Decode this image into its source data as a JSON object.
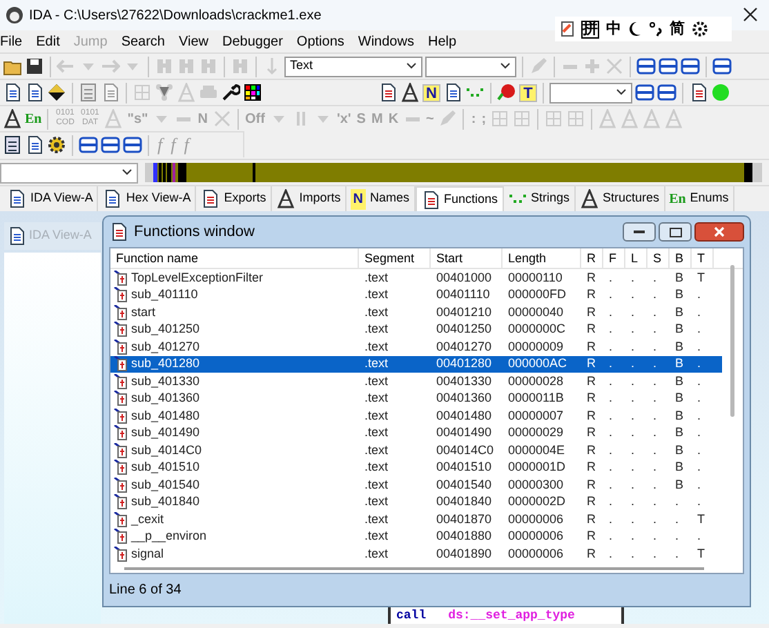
{
  "window": {
    "title": "IDA - C:\\Users\\27622\\Downloads\\crackme1.exe"
  },
  "ime_bar": [
    "拼",
    "中",
    "简"
  ],
  "menu": [
    {
      "label": "File",
      "disabled": false
    },
    {
      "label": "Edit",
      "disabled": false
    },
    {
      "label": "Jump",
      "disabled": true
    },
    {
      "label": "Search",
      "disabled": false
    },
    {
      "label": "View",
      "disabled": false
    },
    {
      "label": "Debugger",
      "disabled": false
    },
    {
      "label": "Options",
      "disabled": false
    },
    {
      "label": "Windows",
      "disabled": false
    },
    {
      "label": "Help",
      "disabled": false
    }
  ],
  "toolbars": [
    [
      {
        "kind": "icon",
        "disabled": false
      },
      {
        "kind": "icon",
        "disabled": false
      },
      {
        "kind": "sep"
      },
      {
        "kind": "icon",
        "disabled": true
      },
      {
        "kind": "icon",
        "disabled": true
      },
      {
        "kind": "icon",
        "disabled": true
      },
      {
        "kind": "icon",
        "disabled": true
      },
      {
        "kind": "sep"
      },
      {
        "kind": "icon",
        "disabled": true
      },
      {
        "kind": "icon",
        "disabled": true
      },
      {
        "kind": "icon",
        "disabled": true
      },
      {
        "kind": "sep"
      },
      {
        "kind": "icon",
        "disabled": true
      },
      {
        "kind": "sep"
      },
      {
        "kind": "icon",
        "disabled": true
      },
      {
        "kind": "combo",
        "value": "Text"
      },
      {
        "kind": "combo"
      },
      {
        "kind": "sep"
      },
      {
        "kind": "icon",
        "disabled": true
      },
      {
        "kind": "sep"
      },
      {
        "kind": "icon",
        "disabled": true
      },
      {
        "kind": "icon",
        "disabled": true
      },
      {
        "kind": "icon",
        "disabled": true
      },
      {
        "kind": "sep"
      },
      {
        "kind": "icon",
        "disabled": false
      },
      {
        "kind": "icon",
        "disabled": false
      },
      {
        "kind": "icon",
        "disabled": false
      },
      {
        "kind": "sep"
      },
      {
        "kind": "icon",
        "disabled": false
      }
    ],
    [
      {
        "kind": "icon",
        "disabled": false
      },
      {
        "kind": "icon",
        "disabled": false
      },
      {
        "kind": "icon",
        "disabled": false
      },
      {
        "kind": "sep"
      },
      {
        "kind": "icon",
        "disabled": true
      },
      {
        "kind": "icon",
        "disabled": true
      },
      {
        "kind": "sep"
      },
      {
        "kind": "icon",
        "disabled": true
      },
      {
        "kind": "icon",
        "disabled": true
      },
      {
        "kind": "icon",
        "disabled": true
      },
      {
        "kind": "icon",
        "disabled": true
      },
      {
        "kind": "icon",
        "disabled": false
      },
      {
        "kind": "icon",
        "disabled": false
      },
      {
        "kind": "gap"
      },
      {
        "kind": "icon",
        "disabled": false
      },
      {
        "kind": "icon",
        "disabled": false
      },
      {
        "kind": "letter",
        "text": "N",
        "disabled": false
      },
      {
        "kind": "icon",
        "disabled": false
      },
      {
        "kind": "icon",
        "disabled": false
      },
      {
        "kind": "sep"
      },
      {
        "kind": "icon",
        "disabled": false
      },
      {
        "kind": "letter",
        "text": "T",
        "disabled": false
      },
      {
        "kind": "sep"
      },
      {
        "kind": "combo"
      },
      {
        "kind": "icon",
        "disabled": false
      },
      {
        "kind": "icon",
        "disabled": false
      },
      {
        "kind": "sep"
      },
      {
        "kind": "icon",
        "disabled": false
      },
      {
        "kind": "icon",
        "disabled": false
      }
    ],
    [
      {
        "kind": "icon",
        "disabled": false
      },
      {
        "kind": "glyph",
        "text": "En",
        "disabled": false
      },
      {
        "kind": "sep"
      },
      {
        "kind": "glyph",
        "text": "0101 COD",
        "disabled": true
      },
      {
        "kind": "glyph",
        "text": "0101 DAT",
        "disabled": true
      },
      {
        "kind": "icon",
        "disabled": true
      },
      {
        "kind": "glyph",
        "text": "\"s\"",
        "disabled": true
      },
      {
        "kind": "icon",
        "disabled": true
      },
      {
        "kind": "icon",
        "disabled": true
      },
      {
        "kind": "glyph",
        "text": "N",
        "disabled": true
      },
      {
        "kind": "icon",
        "disabled": true
      },
      {
        "kind": "sep"
      },
      {
        "kind": "glyph",
        "text": "Off",
        "disabled": true
      },
      {
        "kind": "icon",
        "disabled": true
      },
      {
        "kind": "icon",
        "disabled": true
      },
      {
        "kind": "icon",
        "disabled": true
      },
      {
        "kind": "glyph",
        "text": "'x'",
        "disabled": true
      },
      {
        "kind": "glyph",
        "text": "S",
        "disabled": true
      },
      {
        "kind": "glyph",
        "text": "M",
        "disabled": true
      },
      {
        "kind": "glyph",
        "text": "K",
        "disabled": true
      },
      {
        "kind": "icon",
        "disabled": true
      },
      {
        "kind": "glyph",
        "text": "~",
        "disabled": true
      },
      {
        "kind": "icon",
        "disabled": true
      },
      {
        "kind": "sep"
      },
      {
        "kind": "glyph",
        "text": ":",
        "disabled": true
      },
      {
        "kind": "glyph",
        "text": ";",
        "disabled": true
      },
      {
        "kind": "icon",
        "disabled": true
      },
      {
        "kind": "icon",
        "disabled": true
      },
      {
        "kind": "sep"
      },
      {
        "kind": "icon",
        "disabled": true
      },
      {
        "kind": "icon",
        "disabled": true
      },
      {
        "kind": "sep"
      },
      {
        "kind": "icon",
        "disabled": true
      },
      {
        "kind": "icon",
        "disabled": true
      },
      {
        "kind": "icon",
        "disabled": true
      },
      {
        "kind": "icon",
        "disabled": true
      }
    ],
    [
      {
        "kind": "icon",
        "disabled": false
      },
      {
        "kind": "icon",
        "disabled": false
      },
      {
        "kind": "icon",
        "disabled": false
      },
      {
        "kind": "sep"
      },
      {
        "kind": "icon",
        "disabled": false
      },
      {
        "kind": "icon",
        "disabled": false
      },
      {
        "kind": "icon",
        "disabled": false
      },
      {
        "kind": "sep"
      },
      {
        "kind": "glyph",
        "text": "f",
        "disabled": true
      },
      {
        "kind": "glyph",
        "text": "f",
        "disabled": true
      },
      {
        "kind": "glyph",
        "text": "f",
        "disabled": true
      }
    ]
  ],
  "tabs": [
    {
      "label": "IDA View-A",
      "selected": false
    },
    {
      "label": "Hex View-A",
      "selected": false
    },
    {
      "label": "Exports",
      "selected": false
    },
    {
      "label": "Imports",
      "selected": false
    },
    {
      "label": "Names",
      "glyph": "N",
      "selected": false
    },
    {
      "label": "Functions",
      "selected": true
    },
    {
      "label": "Strings",
      "selected": false
    },
    {
      "label": "Structures",
      "selected": false
    },
    {
      "label": "Enums",
      "glyph": "En",
      "selected": false
    }
  ],
  "background_tab": {
    "label": "IDA View-A"
  },
  "functions_window": {
    "title": "Functions window",
    "columns": [
      "Function name",
      "Segment",
      "Start",
      "Length",
      "R",
      "F",
      "L",
      "S",
      "B",
      "T"
    ],
    "rows": [
      {
        "name": "TopLevelExceptionFilter",
        "segment": ".text",
        "start": "00401000",
        "length": "00000110",
        "flags": [
          "R",
          ".",
          ".",
          ".",
          "B",
          "T"
        ],
        "selected": false
      },
      {
        "name": "sub_401110",
        "segment": ".text",
        "start": "00401110",
        "length": "000000FD",
        "flags": [
          "R",
          ".",
          ".",
          ".",
          "B",
          "."
        ],
        "selected": false
      },
      {
        "name": "start",
        "segment": ".text",
        "start": "00401210",
        "length": "00000040",
        "flags": [
          "R",
          ".",
          ".",
          ".",
          "B",
          "."
        ],
        "selected": false
      },
      {
        "name": "sub_401250",
        "segment": ".text",
        "start": "00401250",
        "length": "0000000C",
        "flags": [
          "R",
          ".",
          ".",
          ".",
          "B",
          "."
        ],
        "selected": false
      },
      {
        "name": "sub_401270",
        "segment": ".text",
        "start": "00401270",
        "length": "00000009",
        "flags": [
          "R",
          ".",
          ".",
          ".",
          "B",
          "."
        ],
        "selected": false
      },
      {
        "name": "sub_401280",
        "segment": ".text",
        "start": "00401280",
        "length": "000000AC",
        "flags": [
          "R",
          ".",
          ".",
          ".",
          "B",
          "."
        ],
        "selected": true
      },
      {
        "name": "sub_401330",
        "segment": ".text",
        "start": "00401330",
        "length": "00000028",
        "flags": [
          "R",
          ".",
          ".",
          ".",
          "B",
          "."
        ],
        "selected": false
      },
      {
        "name": "sub_401360",
        "segment": ".text",
        "start": "00401360",
        "length": "0000011B",
        "flags": [
          "R",
          ".",
          ".",
          ".",
          "B",
          "."
        ],
        "selected": false
      },
      {
        "name": "sub_401480",
        "segment": ".text",
        "start": "00401480",
        "length": "00000007",
        "flags": [
          "R",
          ".",
          ".",
          ".",
          "B",
          "."
        ],
        "selected": false
      },
      {
        "name": "sub_401490",
        "segment": ".text",
        "start": "00401490",
        "length": "00000029",
        "flags": [
          "R",
          ".",
          ".",
          ".",
          "B",
          "."
        ],
        "selected": false
      },
      {
        "name": "sub_4014C0",
        "segment": ".text",
        "start": "004014C0",
        "length": "0000004E",
        "flags": [
          "R",
          ".",
          ".",
          ".",
          "B",
          "."
        ],
        "selected": false
      },
      {
        "name": "sub_401510",
        "segment": ".text",
        "start": "00401510",
        "length": "0000001D",
        "flags": [
          "R",
          ".",
          ".",
          ".",
          "B",
          "."
        ],
        "selected": false
      },
      {
        "name": "sub_401540",
        "segment": ".text",
        "start": "00401540",
        "length": "00000300",
        "flags": [
          "R",
          ".",
          ".",
          ".",
          "B",
          "."
        ],
        "selected": false
      },
      {
        "name": "sub_401840",
        "segment": ".text",
        "start": "00401840",
        "length": "0000002D",
        "flags": [
          "R",
          ".",
          ".",
          ".",
          ".",
          "."
        ],
        "selected": false
      },
      {
        "name": "_cexit",
        "segment": ".text",
        "start": "00401870",
        "length": "00000006",
        "flags": [
          "R",
          ".",
          ".",
          ".",
          ".",
          "T"
        ],
        "selected": false
      },
      {
        "name": "__p__environ",
        "segment": ".text",
        "start": "00401880",
        "length": "00000006",
        "flags": [
          "R",
          ".",
          ".",
          ".",
          ".",
          "."
        ],
        "selected": false
      },
      {
        "name": "signal",
        "segment": ".text",
        "start": "00401890",
        "length": "00000006",
        "flags": [
          "R",
          ".",
          ".",
          ".",
          ".",
          "T"
        ],
        "selected": false
      }
    ],
    "status": "Line 6 of 34"
  },
  "disassembly": {
    "mnemonic": "call",
    "operand": "ds:__set_app_type"
  }
}
